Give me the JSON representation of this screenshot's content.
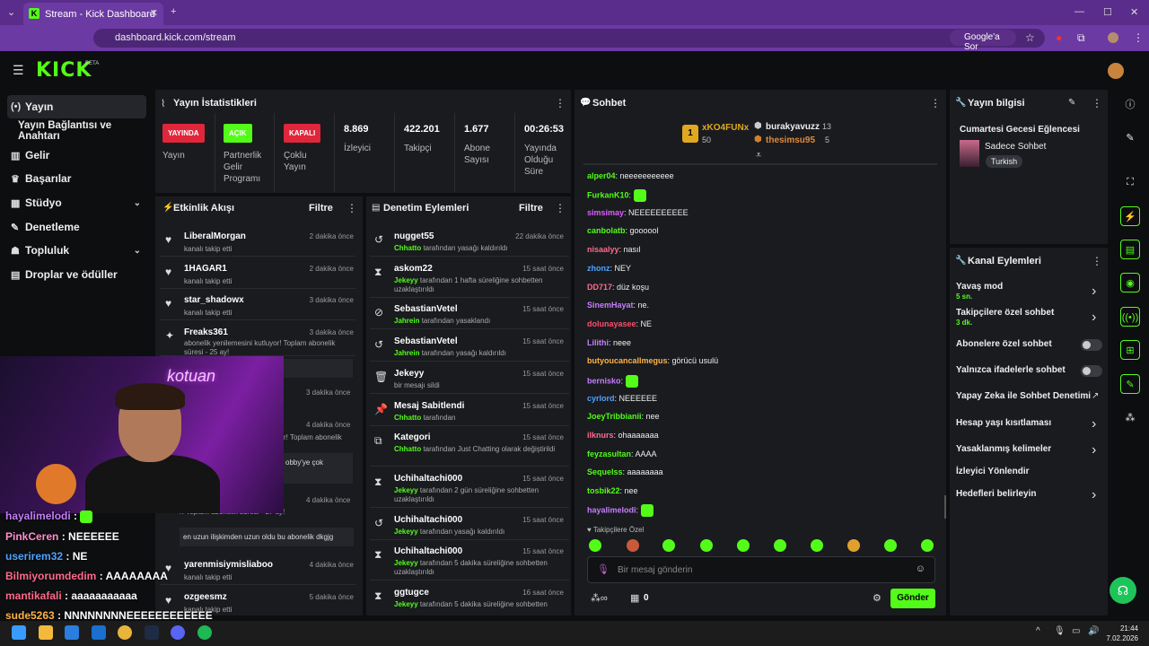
{
  "browser": {
    "tab_title": "Stream - Kick Dashboard",
    "url": "dashboard.kick.com/stream",
    "google_label": "Google'a Sor"
  },
  "kick": {
    "logo": "KICK",
    "beta": "BETA"
  },
  "sidebar": {
    "items": [
      {
        "label": "Yayın"
      },
      {
        "label": "Yayın Bağlantısı ve Anahtarı"
      },
      {
        "label": "Gelir"
      },
      {
        "label": "Başarılar"
      },
      {
        "label": "Stüdyo"
      },
      {
        "label": "Denetleme"
      },
      {
        "label": "Topluluk"
      },
      {
        "label": "Droplar ve ödüller"
      }
    ]
  },
  "stats": {
    "title": "Yayın İstatistikleri",
    "items": [
      {
        "badge": "YAYINDA",
        "label": "Yayın",
        "color": "#e0263b"
      },
      {
        "badge": "AÇIK",
        "label": "Partnerlik Gelir Programı",
        "color": "#53fc18"
      },
      {
        "badge": "KAPALI",
        "label": "Çoklu Yayın",
        "color": "#e0263b"
      },
      {
        "value": "8.869",
        "label": "İzleyici"
      },
      {
        "value": "422.201",
        "label": "Takipçi"
      },
      {
        "value": "1.677",
        "label": "Abone Sayısı"
      },
      {
        "value": "00:26:53",
        "label": "Yayında Olduğu Süre"
      }
    ]
  },
  "activity": {
    "title": "Etkinlik Akışı",
    "filter": "Filtre",
    "rows": [
      {
        "user": "LiberalMorgan",
        "text": "kanalı takip etti",
        "time": "2 dakika önce"
      },
      {
        "user": "1HAGAR1",
        "text": "kanalı takip etti",
        "time": "2 dakika önce"
      },
      {
        "user": "star_shadowx",
        "text": "kanalı takip etti",
        "time": "3 dakika önce"
      },
      {
        "user": "Freaks361",
        "text": "abonelik yenilemesini kutluyor! Toplam abonelik süresi - 25 ay!",
        "time": "3 dakika önce"
      },
      {
        "user": "",
        "text": "",
        "time": "3 dakika önce"
      },
      {
        "user": "",
        "text": "r! Toplam abonelik",
        "time": "4 dakika önce"
      },
      {
        "user": "",
        "text": "obby'ye çok",
        "time": ""
      },
      {
        "user": "",
        "text": "r! Toplam abonelik süresi - 27 ay!",
        "time": "4 dakika önce"
      },
      {
        "user": "",
        "text": "en uzun ilişkimden uzun oldu bu abonelik dkgjg",
        "time": ""
      },
      {
        "user": "yarenmisiymisliaboo",
        "text": "kanalı takip etti",
        "time": "4 dakika önce"
      },
      {
        "user": "ozgeesmz",
        "text": "kanalı takip etti",
        "time": "5 dakika önce"
      }
    ]
  },
  "moderation": {
    "title": "Denetim Eylemleri",
    "filter": "Filtre",
    "rows": [
      {
        "user": "nugget55",
        "actor": "Chhatto",
        "text": " tarafından yasağı kaldırıldı",
        "time": "22 dakika önce"
      },
      {
        "user": "askom22",
        "actor": "Jekeyy",
        "text": " tarafından 1 hafta süreliğine sohbetten uzaklaştırıldı",
        "time": "15 saat önce"
      },
      {
        "user": "SebastianVetel",
        "actor": "Jahrein",
        "text": " tarafından yasaklandı",
        "time": "15 saat önce"
      },
      {
        "user": "SebastianVetel",
        "actor": "Jahrein",
        "text": " tarafından yasağı kaldırıldı",
        "time": "15 saat önce"
      },
      {
        "user": "Jekeyy",
        "actor": "",
        "text": "bir mesajı sildi",
        "time": "15 saat önce"
      },
      {
        "user": "Mesaj Sabitlendi",
        "actor": "Chhatto",
        "text": " tarafından",
        "time": "15 saat önce"
      },
      {
        "user": "Kategori",
        "actor": "Chhatto",
        "text": " tarafından Just Chatting olarak değiştirildi",
        "time": "15 saat önce"
      },
      {
        "user": "Uchihaltachi000",
        "actor": "Jekeyy",
        "text": " tarafından 2 gün süreliğine sohbetten uzaklaştırıldı",
        "time": "15 saat önce"
      },
      {
        "user": "Uchihaltachi000",
        "actor": "Jekeyy",
        "text": " tarafından yasağı kaldırıldı",
        "time": "15 saat önce"
      },
      {
        "user": "Uchihaltachi000",
        "actor": "Jekeyy",
        "text": " tarafından 5 dakika süreliğine sohbetten uzaklaştırıldı",
        "time": "15 saat önce"
      },
      {
        "user": "ggtugce",
        "actor": "Jekeyy",
        "text": " tarafından 5 dakika süreliğine sohbetten",
        "time": "16 saat önce"
      }
    ]
  },
  "chat": {
    "title": "Sohbet",
    "top": {
      "first": "xKO4FUNx",
      "first_count": "50",
      "second": "burakyavuzz",
      "second_count": "13",
      "third": "thesimsu95",
      "third_count": "5"
    },
    "messages": [
      {
        "name": "alper04",
        "text": "neeeeeeeeeee",
        "color": "#53fc18"
      },
      {
        "name": "FurkanK10",
        "text": "",
        "color": "#53fc18"
      },
      {
        "name": "simsimay",
        "text": "NEEEEEEEEEE",
        "color": "#e05cff"
      },
      {
        "name": "canbolatb",
        "text": "goooool",
        "color": "#53fc18"
      },
      {
        "name": "nisaalyy",
        "text": "nasıl",
        "color": "#ff6a8c"
      },
      {
        "name": "zhonz",
        "text": "NEY",
        "color": "#4fa3ff"
      },
      {
        "name": "DD717",
        "text": "düz koşu",
        "color": "#ff6a8c"
      },
      {
        "name": "SinemHayat",
        "text": "ne.",
        "color": "#c77dff"
      },
      {
        "name": "dolunayasee",
        "text": "NE",
        "color": "#ff4d6d"
      },
      {
        "name": "Lilithi",
        "text": "neee",
        "color": "#c77dff"
      },
      {
        "name": "butyoucancallmegus",
        "text": "görücü usulü",
        "color": "#ffb347"
      },
      {
        "name": "bernisko",
        "text": "",
        "color": "#c77dff"
      },
      {
        "name": "cyrlord",
        "text": "NEEEEEE",
        "color": "#4fa3ff"
      },
      {
        "name": "JoeyTribbianii",
        "text": "nee",
        "color": "#53fc18"
      },
      {
        "name": "ilknurs",
        "text": "ohaaaaaaa",
        "color": "#ff6a8c"
      },
      {
        "name": "feyzasultan",
        "text": "AAAA",
        "color": "#53fc18"
      },
      {
        "name": "Sequelss",
        "text": "aaaaaaaa",
        "color": "#53fc18"
      },
      {
        "name": "tosbik22",
        "text": "nee",
        "color": "#53fc18"
      },
      {
        "name": "hayalimelodi",
        "text": "",
        "color": "#c77dff"
      }
    ],
    "followers_only": "Takipçilere Özel",
    "placeholder": "Bir mesaj gönderin",
    "count": "0",
    "send": "Gönder"
  },
  "stream_info": {
    "title": "Yayın bilgisi",
    "stream_title": "Cumartesi Gecesi Eğlencesi",
    "category": "Sadece Sohbet",
    "language": "Turkish"
  },
  "channel_actions": {
    "title": "Kanal Eylemleri",
    "items": [
      {
        "label": "Yavaş mod",
        "sub": "5 sn.",
        "type": "arrow"
      },
      {
        "label": "Takipçilere özel sohbet",
        "sub": "3 dk.",
        "type": "arrow"
      },
      {
        "label": "Abonelere özel sohbet",
        "sub": "",
        "type": "toggle"
      },
      {
        "label": "Yalnızca ifadelerle sohbet",
        "sub": "",
        "type": "toggle"
      },
      {
        "label": "Yapay Zeka ile Sohbet Denetimi",
        "sub": "",
        "type": "ext"
      },
      {
        "label": "Hesap yaşı kısıtlaması",
        "sub": "",
        "type": "arrow"
      },
      {
        "label": "Yasaklanmış kelimeler",
        "sub": "",
        "type": "arrow"
      },
      {
        "label": "İzleyici Yönlendir",
        "sub": "",
        "type": "none"
      },
      {
        "label": "Hedefleri belirleyin",
        "sub": "",
        "type": "arrow"
      }
    ]
  },
  "overlay_chat": [
    {
      "name": "hayalimelodi",
      "text": "",
      "color": "#c77dff"
    },
    {
      "name": "PinkCeren",
      "text": "NEEEEEE",
      "color": "#ff8fcf"
    },
    {
      "name": "userirem32",
      "text": "NE",
      "color": "#4fa3ff"
    },
    {
      "name": "Bilmiyorumdedim",
      "text": "AAAAAAAA",
      "color": "#ff6a8c"
    },
    {
      "name": "mantikafali",
      "text": "aaaaaaaaaaa",
      "color": "#ff6a8c"
    },
    {
      "name": "sude5263",
      "text": "NNNNNNNNEEEEEEEEEEEE",
      "color": "#ffb347"
    }
  ],
  "cam_text": "kotuan",
  "clock": {
    "time": "21:44",
    "date": "7.02.2026"
  }
}
